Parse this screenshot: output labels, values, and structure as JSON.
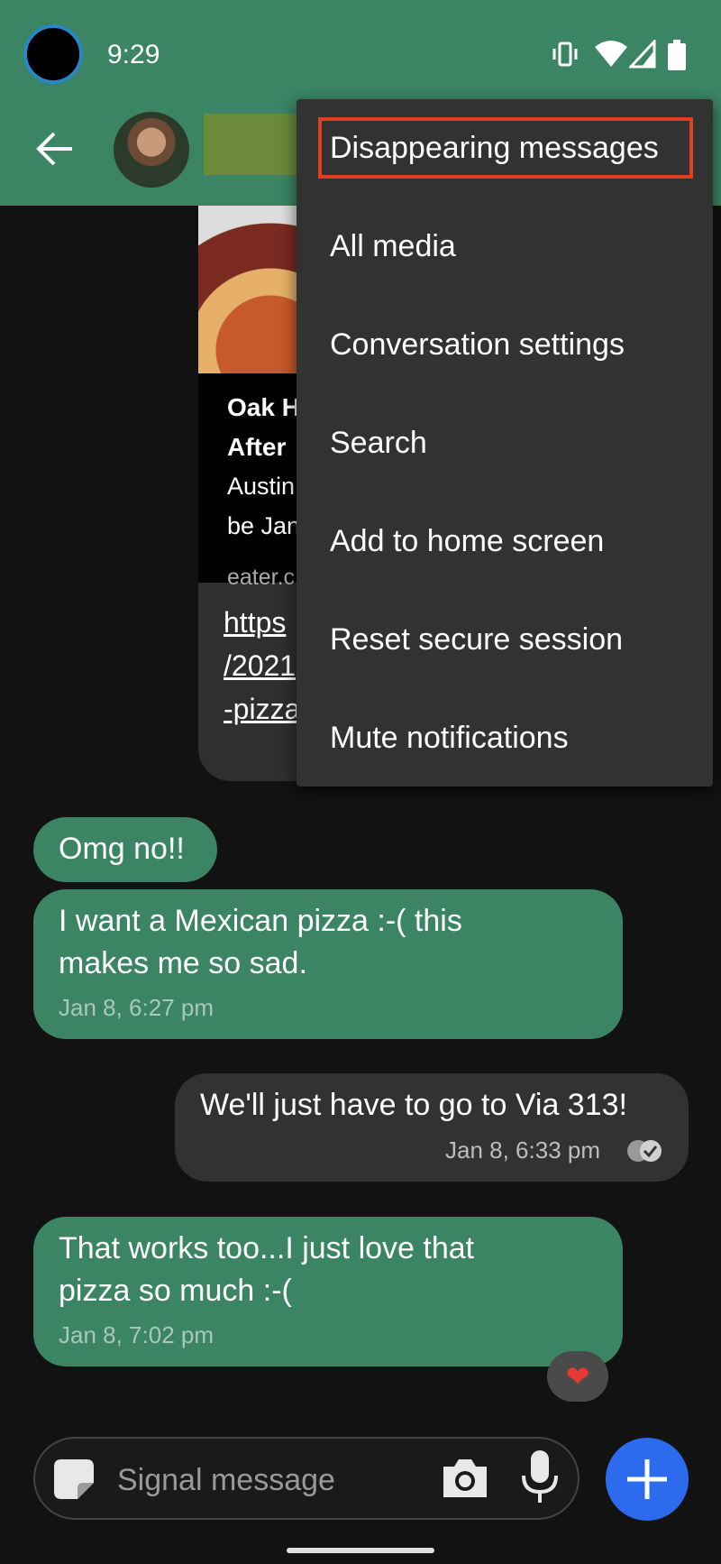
{
  "status_bar": {
    "time": "9:29"
  },
  "header": {
    "back_icon": "arrow-left-icon"
  },
  "link_preview": {
    "title_line1": "Oak H",
    "title_line2": "After",
    "desc_line1": "Austin",
    "desc_line2": "be Jan",
    "domain": "eater.c",
    "url_line1": "https",
    "url_line2": "/2021",
    "url_line3": "-pizza"
  },
  "menu": {
    "items": [
      {
        "label": "Disappearing messages"
      },
      {
        "label": "All media"
      },
      {
        "label": "Conversation settings"
      },
      {
        "label": "Search"
      },
      {
        "label": "Add to home screen"
      },
      {
        "label": "Reset secure session"
      },
      {
        "label": "Mute notifications"
      }
    ],
    "highlight_color": "#e0401f"
  },
  "messages": [
    {
      "direction": "in",
      "line1": "Omg no!!"
    },
    {
      "direction": "in",
      "line1": "I want a Mexican pizza :-( this",
      "line2": "makes me so sad.",
      "time": "Jan 8, 6:27 pm"
    },
    {
      "direction": "out",
      "line1": "We'll just have to go to Via 313!",
      "time": "Jan 8, 6:33 pm"
    },
    {
      "direction": "in",
      "line1": "That works too...I just love that",
      "line2": "pizza so much :-(",
      "time": "Jan 8, 7:02 pm",
      "reaction": "❤"
    }
  ],
  "composer": {
    "placeholder": "Signal message"
  },
  "colors": {
    "accent_green": "#3b8464",
    "background": "#121212",
    "menu_bg": "#323232",
    "attach_blue": "#2c6bed"
  }
}
